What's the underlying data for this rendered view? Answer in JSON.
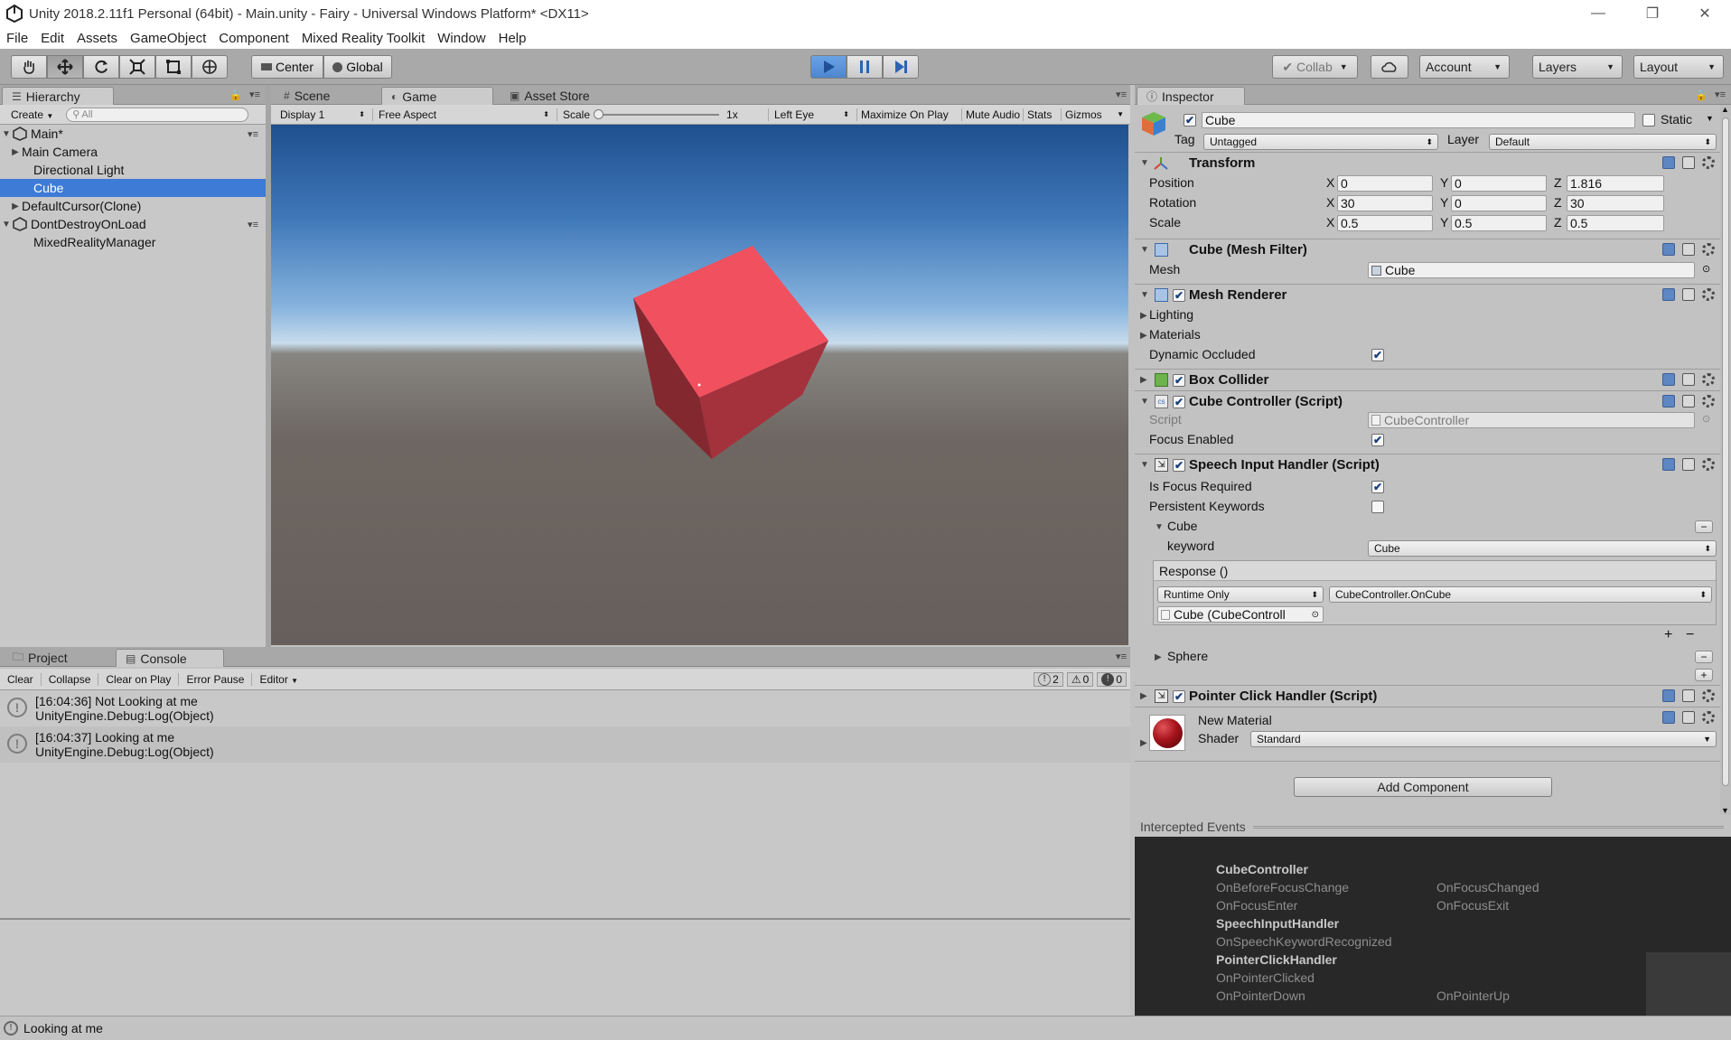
{
  "window": {
    "title": "Unity 2018.2.11f1 Personal (64bit) - Main.unity - Fairy - Universal Windows Platform* <DX11>",
    "minimize": "—",
    "maximize": "❐",
    "close": "✕"
  },
  "menu": [
    "File",
    "Edit",
    "Assets",
    "GameObject",
    "Component",
    "Mixed Reality Toolkit",
    "Window",
    "Help"
  ],
  "toolbar": {
    "pivot": "Center",
    "space": "Global",
    "collab": "Collab",
    "account": "Account",
    "layers": "Layers",
    "layout": "Layout",
    "play_state": "playing"
  },
  "hierarchy": {
    "tab": "Hierarchy",
    "create": "Create",
    "search_placeholder": "All",
    "items": [
      {
        "label": "Main*",
        "depth": 0,
        "kind": "scene",
        "expanded": true
      },
      {
        "label": "Main Camera",
        "depth": 1,
        "kind": "object",
        "foldable": true
      },
      {
        "label": "Directional Light",
        "depth": 1,
        "kind": "object"
      },
      {
        "label": "Cube",
        "depth": 1,
        "kind": "object",
        "selected": true
      },
      {
        "label": "DefaultCursor(Clone)",
        "depth": 1,
        "kind": "object",
        "foldable": true
      },
      {
        "label": "DontDestroyOnLoad",
        "depth": 0,
        "kind": "scene",
        "expanded": true
      },
      {
        "label": "MixedRealityManager",
        "depth": 1,
        "kind": "object"
      }
    ]
  },
  "view_tabs": {
    "scene": "Scene",
    "game": "Game",
    "asset_store": "Asset Store"
  },
  "game_bar": {
    "display": "Display 1",
    "aspect": "Free Aspect",
    "scale_label": "Scale",
    "scale_value": "1x",
    "eye": "Left Eye",
    "maximize": "Maximize On Play",
    "mute": "Mute Audio",
    "stats": "Stats",
    "gizmos": "Gizmos"
  },
  "bottom_tabs": {
    "project": "Project",
    "console": "Console"
  },
  "console_bar": {
    "clear": "Clear",
    "collapse": "Collapse",
    "clear_on_play": "Clear on Play",
    "error_pause": "Error Pause",
    "editor": "Editor",
    "log_count": "2",
    "warn_count": "0",
    "error_count": "0"
  },
  "console": [
    {
      "line1": "[16:04:36] Not Looking at me",
      "line2": "UnityEngine.Debug:Log(Object)"
    },
    {
      "line1": "[16:04:37] Looking at me",
      "line2": "UnityEngine.Debug:Log(Object)"
    }
  ],
  "status": {
    "message": "Looking at me"
  },
  "inspector": {
    "tab": "Inspector",
    "name": "Cube",
    "static": "Static",
    "tag_label": "Tag",
    "tag": "Untagged",
    "layer_label": "Layer",
    "layer": "Default",
    "transform": {
      "title": "Transform",
      "position_label": "Position",
      "rotation_label": "Rotation",
      "scale_label": "Scale",
      "axis_x": "X",
      "axis_y": "Y",
      "axis_z": "Z",
      "position": [
        "0",
        "0",
        "1.816"
      ],
      "rotation": [
        "30",
        "0",
        "30"
      ],
      "scale": [
        "0.5",
        "0.5",
        "0.5"
      ]
    },
    "mesh_filter": {
      "title": "Cube (Mesh Filter)",
      "mesh_label": "Mesh",
      "mesh": "Cube"
    },
    "mesh_renderer": {
      "title": "Mesh Renderer",
      "lighting": "Lighting",
      "materials": "Materials",
      "dynamic_occluded": "Dynamic Occluded"
    },
    "box_collider": {
      "title": "Box Collider"
    },
    "cube_controller": {
      "title": "Cube Controller (Script)",
      "script_label": "Script",
      "script": "CubeController",
      "focus_enabled": "Focus Enabled"
    },
    "speech_input": {
      "title": "Speech Input Handler (Script)",
      "is_focus_required": "Is Focus Required",
      "persistent_keywords": "Persistent Keywords",
      "keyword_group": "Cube",
      "keyword_label": "keyword",
      "keyword": "Cube",
      "response": "Response ()",
      "runtime": "Runtime Only",
      "function": "CubeController.OnCube",
      "target": "Cube (CubeControll",
      "sphere": "Sphere",
      "plus": "+",
      "minus": "−"
    },
    "pointer_click": {
      "title": "Pointer Click Handler (Script)"
    },
    "material": {
      "name": "New Material",
      "shader_label": "Shader",
      "shader": "Standard"
    },
    "add_component": "Add Component"
  },
  "events": {
    "title": "Intercepted Events",
    "groups": [
      {
        "name": "CubeController",
        "items": [
          "OnBeforeFocusChange",
          "OnFocusChanged",
          "OnFocusEnter",
          "OnFocusExit"
        ]
      },
      {
        "name": "SpeechInputHandler",
        "items": [
          "OnSpeechKeywordRecognized"
        ]
      },
      {
        "name": "PointerClickHandler",
        "items": [
          "OnPointerClicked",
          "OnPointerDown",
          "OnPointerUp"
        ]
      }
    ]
  },
  "colors": {
    "selection": "#3d7bd6",
    "cube": "#f1505f",
    "play_active": "#4d86cf"
  }
}
